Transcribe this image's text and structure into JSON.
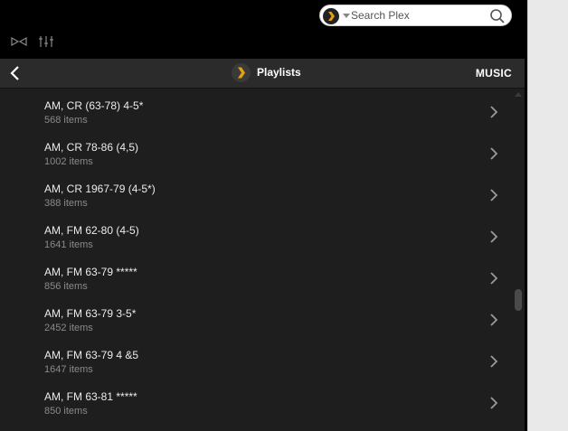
{
  "search": {
    "placeholder": "Search Plex"
  },
  "header": {
    "title": "Playlists",
    "section": "MUSIC"
  },
  "playlists": [
    {
      "name": "AM, CR (63-78) 4-5*",
      "count": "568 items"
    },
    {
      "name": "AM, CR 78-86 (4,5)",
      "count": "1002 items"
    },
    {
      "name": "AM, CR 1967-79 (4-5*)",
      "count": "388 items"
    },
    {
      "name": "AM, FM 62-80 (4-5)",
      "count": "1641 items"
    },
    {
      "name": "AM, FM 63-79 *****",
      "count": "856 items"
    },
    {
      "name": "AM, FM 63-79 3-5*",
      "count": "2452 items"
    },
    {
      "name": "AM, FM 63-79 4 &5",
      "count": "1647 items"
    },
    {
      "name": "AM, FM 63-81 *****",
      "count": "850 items"
    }
  ],
  "icons": {
    "brand": "plex-logo-icon",
    "search": "search-icon",
    "back": "back-arrow-icon",
    "merge": "merge-icon",
    "equalizer": "equalizer-icon",
    "row": "chevron-right-icon"
  },
  "colors": {
    "accent": "#e5a00d",
    "background": "#000000",
    "list": "#1e1e1e"
  }
}
